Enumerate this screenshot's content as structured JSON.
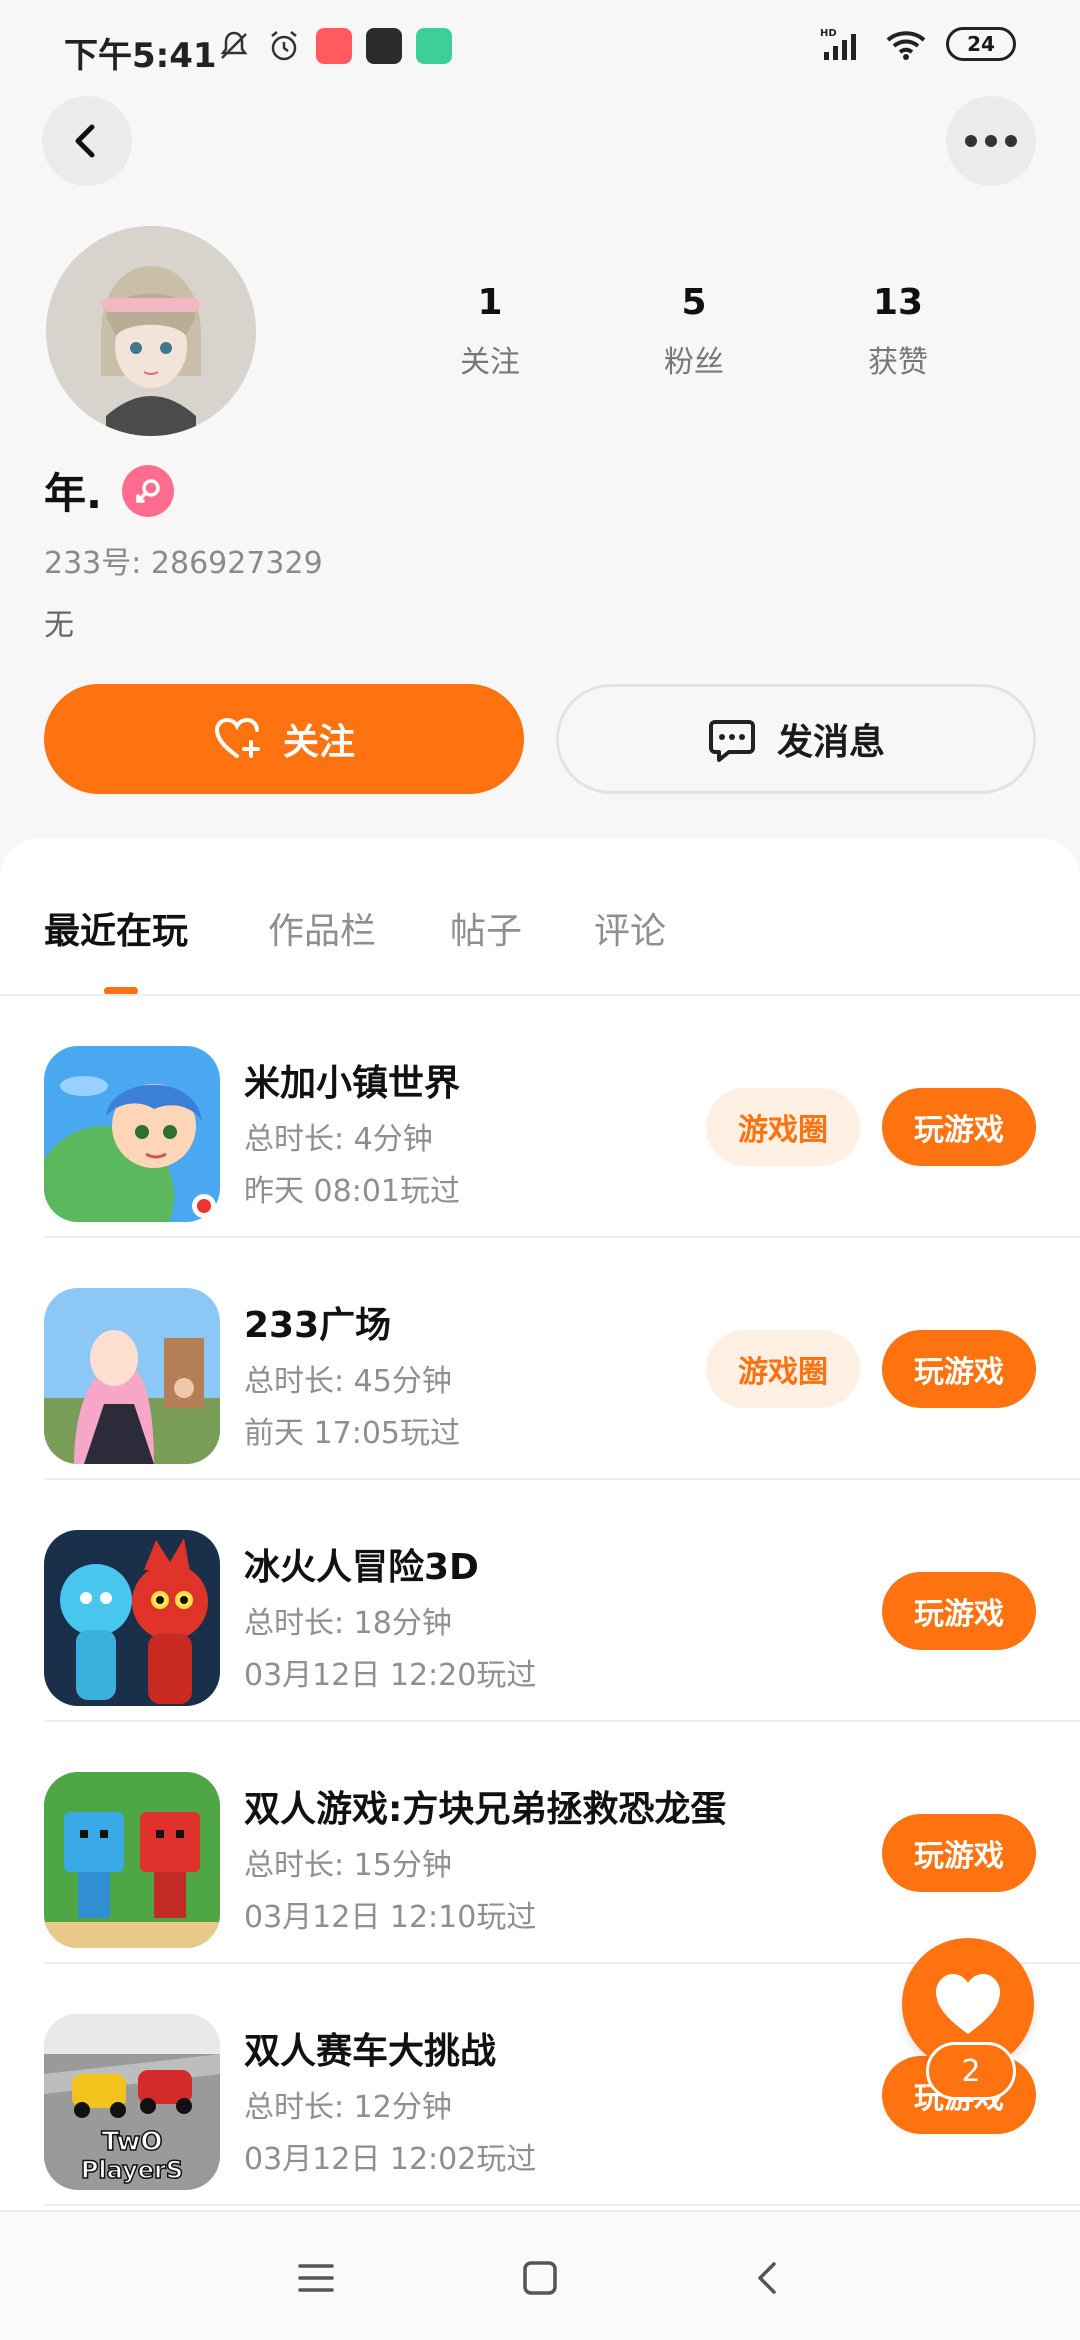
{
  "status_bar": {
    "time": "下午5:41",
    "battery": "24",
    "signal_label": "HD"
  },
  "profile": {
    "name": "年.",
    "uid": "233号: 286927329",
    "bio": "无",
    "stats": [
      {
        "value": "1",
        "label": "关注"
      },
      {
        "value": "5",
        "label": "粉丝"
      },
      {
        "value": "13",
        "label": "获赞"
      }
    ],
    "follow_label": "关注",
    "message_label": "发消息"
  },
  "tabs": [
    {
      "label": "最近在玩",
      "active": true
    },
    {
      "label": "作品栏",
      "active": false
    },
    {
      "label": "帖子",
      "active": false
    },
    {
      "label": "评论",
      "active": false
    }
  ],
  "games": [
    {
      "title": "米加小镇世界",
      "duration": "总时长: 4分钟",
      "last_played": "昨天 08:01玩过",
      "circle_label": "游戏圈",
      "play_label": "玩游戏"
    },
    {
      "title": "233广场",
      "duration": "总时长: 45分钟",
      "last_played": "前天 17:05玩过",
      "circle_label": "游戏圈",
      "play_label": "玩游戏"
    },
    {
      "title": "冰火人冒险3D",
      "duration": "总时长: 18分钟",
      "last_played": "03月12日 12:20玩过",
      "play_label": "玩游戏"
    },
    {
      "title": "双人游戏:方块兄弟拯救恐龙蛋",
      "duration": "总时长: 15分钟",
      "last_played": "03月12日 12:10玩过",
      "play_label": "玩游戏"
    },
    {
      "title": "双人赛车大挑战",
      "duration": "总时长: 12分钟",
      "last_played": "03月12日 12:02玩过",
      "play_label": "玩游戏",
      "icon_text_1": "TwO",
      "icon_text_2": "PlayerS"
    }
  ],
  "like_fab": {
    "count": "2"
  },
  "colors": {
    "accent": "#ff7210",
    "accent_light": "#fff0e4",
    "female": "#ff6c8f"
  }
}
